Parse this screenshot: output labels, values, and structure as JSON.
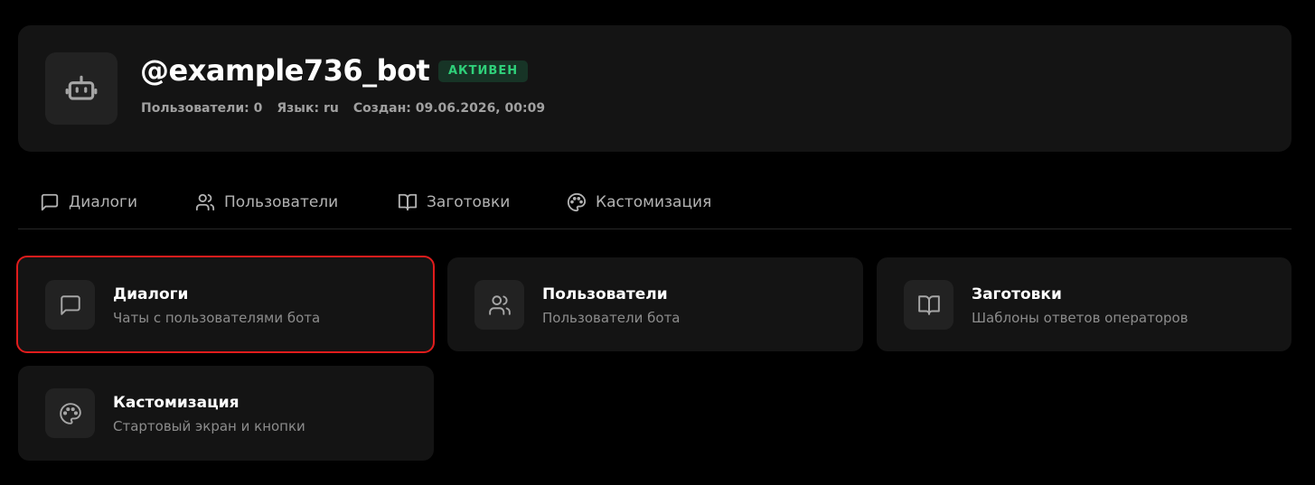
{
  "bot": {
    "username": "@example736_bot",
    "status": "АКТИВЕН",
    "users_meta": "Пользователи: 0",
    "language_meta": "Язык: ru",
    "created_meta": "Создан: 09.06.2026, 00:09"
  },
  "tabs": [
    {
      "label": "Диалоги",
      "icon": "chat-icon"
    },
    {
      "label": "Пользователи",
      "icon": "users-icon"
    },
    {
      "label": "Заготовки",
      "icon": "book-icon"
    },
    {
      "label": "Кастомизация",
      "icon": "palette-icon"
    }
  ],
  "cards": [
    {
      "title": "Диалоги",
      "description": "Чаты с пользователями бота",
      "icon": "chat-icon",
      "selected": true
    },
    {
      "title": "Пользователи",
      "description": "Пользователи бота",
      "icon": "users-icon"
    },
    {
      "title": "Заготовки",
      "description": "Шаблоны ответов операторов",
      "icon": "book-icon"
    },
    {
      "title": "Кастомизация",
      "description": "Стартовый экран и кнопки",
      "icon": "palette-icon"
    }
  ],
  "colors": {
    "background": "#000000",
    "card": "#141414",
    "status_active": "#2fd07a",
    "selection": "#e01c1c"
  }
}
